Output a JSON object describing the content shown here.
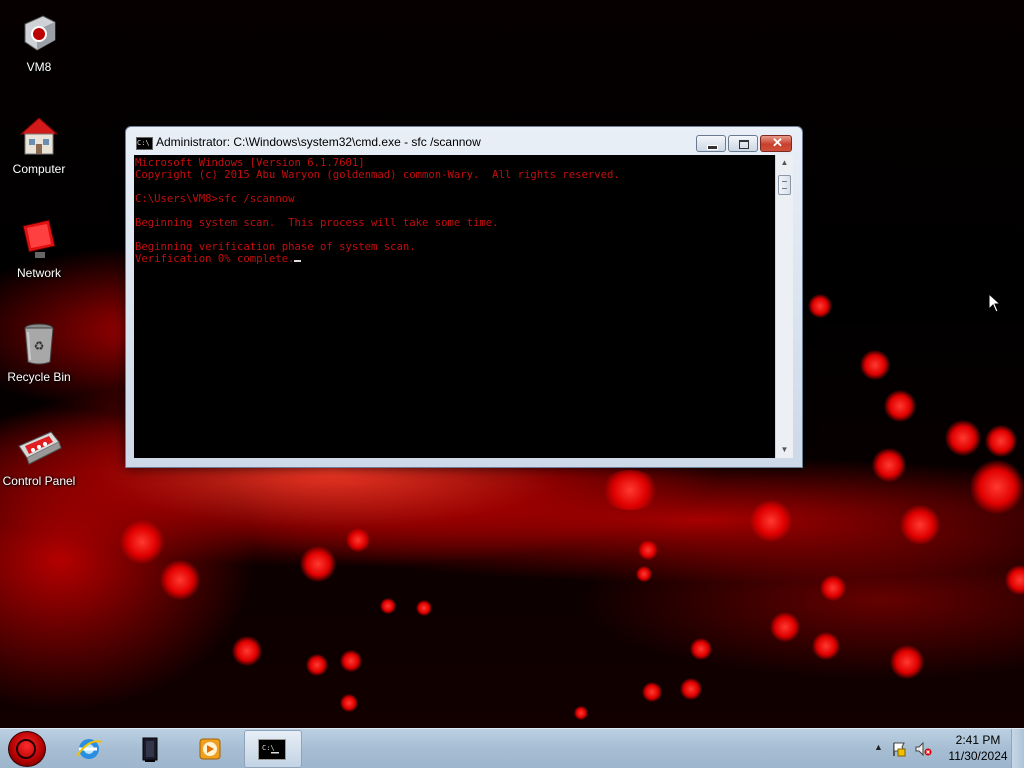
{
  "desktop": {
    "icons": [
      {
        "label": "VM8",
        "icon": "vm-icon"
      },
      {
        "label": "Computer",
        "icon": "computer-icon"
      },
      {
        "label": "Network",
        "icon": "network-icon"
      },
      {
        "label": "Recycle Bin",
        "icon": "recycle-bin-icon"
      },
      {
        "label": "Control Panel",
        "icon": "control-panel-icon"
      }
    ],
    "wallpaper_accent": "#e00000"
  },
  "window": {
    "title": "Administrator: C:\\Windows\\system32\\cmd.exe - sfc  /scannow",
    "console_lines": [
      "Microsoft Windows [Version 6.1.7601]",
      "Copyright (c) 2015 Abu Waryon (goldenmad) common-Wary.  All rights reserved.",
      "",
      "C:\\Users\\VM8>sfc /scannow",
      "",
      "Beginning system scan.  This process will take some time.",
      "",
      "Beginning verification phase of system scan.",
      "Verification 0% complete."
    ],
    "console_text_color": "#c40d0d"
  },
  "taskbar": {
    "pinned": [
      {
        "name": "internet-explorer-icon"
      },
      {
        "name": "media-center-icon"
      },
      {
        "name": "media-player-icon"
      },
      {
        "name": "command-prompt-icon",
        "active": true
      }
    ],
    "clock": {
      "time": "2:41 PM",
      "date": "11/30/2024"
    }
  }
}
